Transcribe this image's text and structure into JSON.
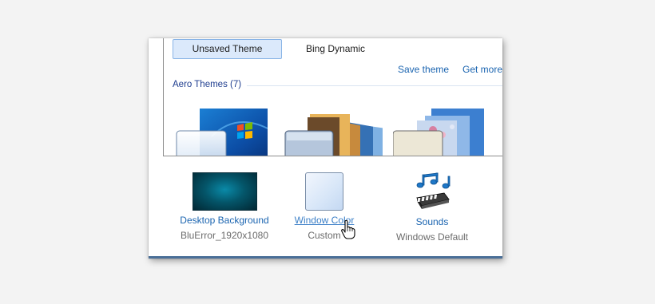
{
  "themes": {
    "tabs": [
      {
        "label": "Unsaved Theme",
        "selected": true
      },
      {
        "label": "Bing Dynamic",
        "selected": false
      }
    ],
    "save_link": "Save theme",
    "get_more_link": "Get more",
    "group_title": "Aero Themes (7)"
  },
  "bottom": {
    "desktop_background": {
      "label": "Desktop Background",
      "value": "BluError_1920x1080"
    },
    "window_color": {
      "label": "Window Color",
      "value": "Custom"
    },
    "sounds": {
      "label": "Sounds",
      "value": "Windows Default"
    }
  },
  "colors": {
    "link": "#1a64b0",
    "group_header": "#1e3d8f",
    "selected_tab_bg": "#dbe9fb"
  },
  "icons": [
    "windows-logo-thumbnail",
    "landscape-stack-thumbnail",
    "flowers-stack-thumbnail",
    "music-notes-icon",
    "hand-cursor-icon"
  ]
}
